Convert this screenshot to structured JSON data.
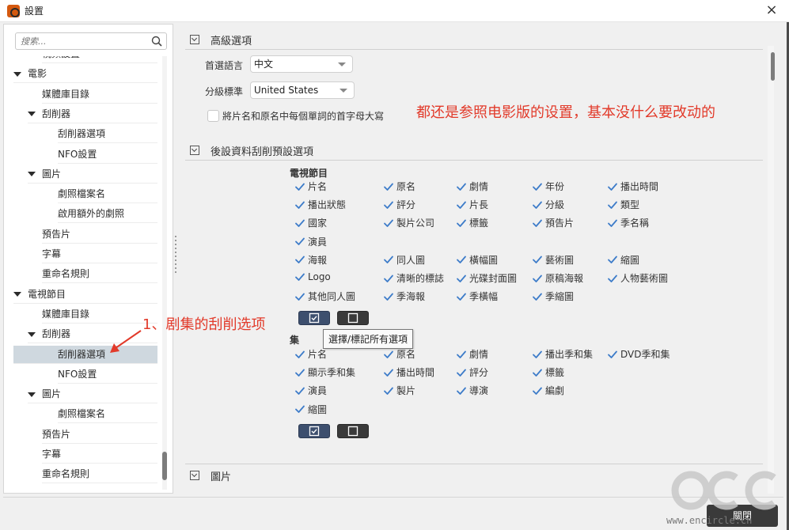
{
  "window": {
    "title": "設置",
    "close_label": "×"
  },
  "sidebar": {
    "search_placeholder": "搜索...",
    "items": [
      {
        "label": "視頻設置",
        "level": 1
      },
      {
        "label": "電影",
        "level": 0,
        "expanded": true
      },
      {
        "label": "媒體庫目錄",
        "level": 1
      },
      {
        "label": "刮削器",
        "level": 1,
        "expanded": true
      },
      {
        "label": "刮削器選項",
        "level": 2
      },
      {
        "label": "NFO設置",
        "level": 2
      },
      {
        "label": "圖片",
        "level": 1,
        "expanded": true
      },
      {
        "label": "劇照檔案名",
        "level": 2
      },
      {
        "label": "啟用額外的劇照",
        "level": 2
      },
      {
        "label": "預告片",
        "level": 1
      },
      {
        "label": "字幕",
        "level": 1
      },
      {
        "label": "重命名規則",
        "level": 1
      },
      {
        "label": "電視節目",
        "level": 0,
        "expanded": true
      },
      {
        "label": "媒體庫目錄",
        "level": 1
      },
      {
        "label": "刮削器",
        "level": 1,
        "expanded": true
      },
      {
        "label": "刮削器選項",
        "level": 2,
        "selected": true
      },
      {
        "label": "NFO設置",
        "level": 2
      },
      {
        "label": "圖片",
        "level": 1,
        "expanded": true
      },
      {
        "label": "劇照檔案名",
        "level": 2
      },
      {
        "label": "預告片",
        "level": 1
      },
      {
        "label": "字幕",
        "level": 1
      },
      {
        "label": "重命名規則",
        "level": 1
      }
    ]
  },
  "main": {
    "advanced": {
      "title": "高級選項",
      "language_label": "首選語言",
      "language_value": "中文",
      "rating_label": "分級標準",
      "rating_value": "United States",
      "capitalize_label": "將片名和原名中每個單詞的首字母大寫"
    },
    "annotation_right": "都还是参照电影版的设置，基本没什么要改动的",
    "annotation_left": "1、剧集的刮削选项",
    "post_scrape": {
      "title": "後設資料刮削預設選項",
      "tvshow_title": "電視節目",
      "tvshow_items": [
        "片名",
        "原名",
        "劇情",
        "年份",
        "播出時間",
        "播出狀態",
        "評分",
        "片長",
        "分級",
        "類型",
        "國家",
        "製片公司",
        "標籤",
        "預告片",
        "季名稱",
        "演員",
        "海報",
        "同人圖",
        "橫幅圖",
        "藝術圖",
        "縮圖",
        "Logo",
        "清晰的標誌",
        "光碟封面圖",
        "原稿海報",
        "人物藝術圖",
        "其他同人圖",
        "季海報",
        "季橫幅",
        "季縮圖"
      ],
      "episode_title": "集",
      "episode_items": [
        "片名",
        "原名",
        "劇情",
        "播出季和集",
        "DVD季和集",
        "顯示季和集",
        "播出時間",
        "評分",
        "標籤",
        "演員",
        "製片",
        "導演",
        "編劇",
        "縮圖"
      ],
      "tooltip": "選擇/標記所有選項"
    },
    "images": {
      "title": "圖片"
    }
  },
  "footer": {
    "close_label": "關閉",
    "watermark": "www.encircle.cn"
  },
  "colors": {
    "check": "#3d7cc9",
    "annotation": "#e23a2a",
    "selected": "#cfd8df"
  }
}
